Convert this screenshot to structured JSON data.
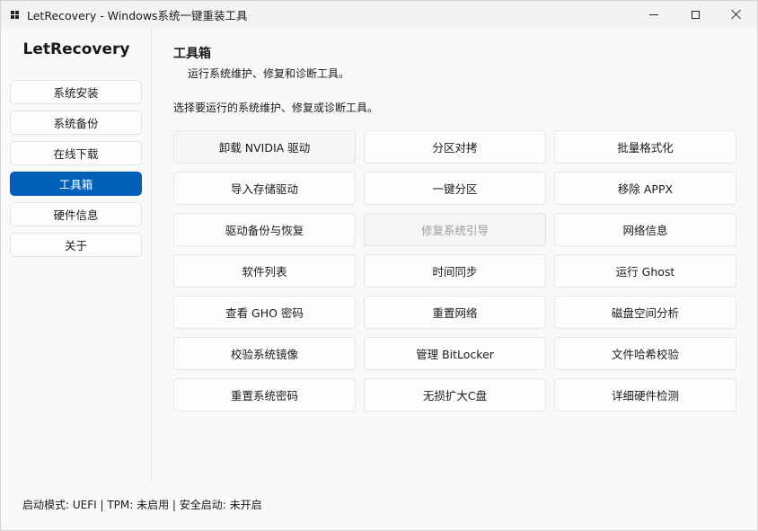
{
  "window": {
    "title": "LetRecovery - Windows系统一键重装工具"
  },
  "sidebar": {
    "app_name": "LetRecovery",
    "items": [
      {
        "label": "系统安装"
      },
      {
        "label": "系统备份"
      },
      {
        "label": "在线下载"
      },
      {
        "label": "工具箱",
        "active": true
      },
      {
        "label": "硬件信息"
      },
      {
        "label": "关于"
      }
    ]
  },
  "main": {
    "title": "工具箱",
    "subtitle": "运行系统维护、修复和诊断工具。",
    "description": "选择要运行的系统维护、修复或诊断工具。",
    "tools": [
      {
        "label": "卸载 NVIDIA 驱动",
        "state": "hover"
      },
      {
        "label": "分区对拷"
      },
      {
        "label": "批量格式化"
      },
      {
        "label": "导入存储驱动"
      },
      {
        "label": "一键分区"
      },
      {
        "label": "移除 APPX"
      },
      {
        "label": "驱动备份与恢复"
      },
      {
        "label": "修复系统引导",
        "state": "disabled"
      },
      {
        "label": "网络信息"
      },
      {
        "label": "软件列表"
      },
      {
        "label": "时间同步"
      },
      {
        "label": "运行 Ghost"
      },
      {
        "label": "查看 GHO 密码"
      },
      {
        "label": "重置网络"
      },
      {
        "label": "磁盘空间分析"
      },
      {
        "label": "校验系统镜像"
      },
      {
        "label": "管理 BitLocker"
      },
      {
        "label": "文件哈希校验"
      },
      {
        "label": "重置系统密码"
      },
      {
        "label": "无损扩大C盘"
      },
      {
        "label": "详细硬件检测"
      }
    ]
  },
  "status": {
    "text": "启动模式: UEFI | TPM: 未启用 | 安全启动: 未开启"
  },
  "colors": {
    "accent": "#005fb8",
    "background": "#f9f9f9",
    "disabled_text": "#9d9d9d"
  }
}
